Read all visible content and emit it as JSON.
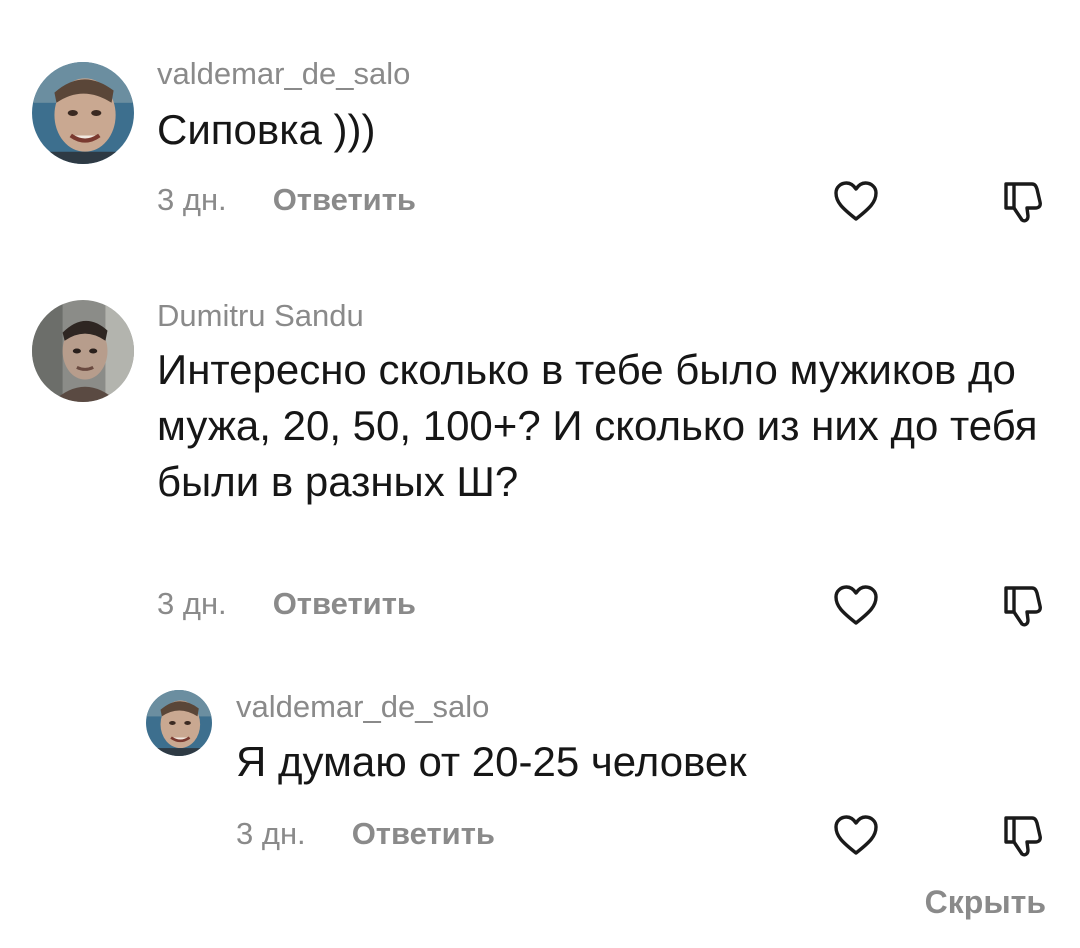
{
  "comments": [
    {
      "username": "valdemar_de_salo",
      "text": "Сиповка )))",
      "time": "3 дн.",
      "reply_label": "Ответить"
    },
    {
      "username": "Dumitru Sandu",
      "text": "Интересно сколько в тебе было мужиков до мужа, 20, 50, 100+? И сколько из них до тебя были в разных Ш?",
      "time": "3 дн.",
      "reply_label": "Ответить"
    },
    {
      "username": "valdemar_de_salo",
      "text": "Я думаю от 20-25 человек",
      "time": "3 дн.",
      "reply_label": "Ответить"
    }
  ],
  "hide_label": "Скрыть",
  "icons": {
    "like": "heart-icon",
    "dislike": "thumbs-down-icon"
  },
  "colors": {
    "text": "#161616",
    "secondary": "#8a8a8a",
    "background": "#ffffff"
  }
}
